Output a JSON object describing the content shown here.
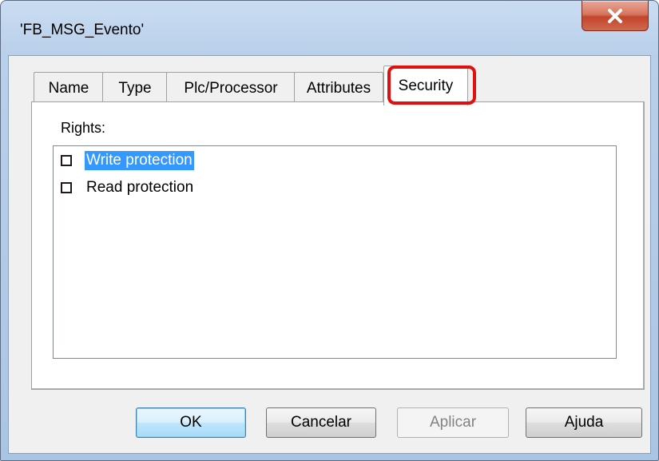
{
  "window": {
    "title": "'FB_MSG_Evento'",
    "close_label": "X"
  },
  "tabs": [
    {
      "label": "Name",
      "active": false
    },
    {
      "label": "Type",
      "active": false
    },
    {
      "label": "Plc/Processor",
      "active": false
    },
    {
      "label": "Attributes",
      "active": false
    },
    {
      "label": "Security",
      "active": true
    }
  ],
  "security": {
    "rights_label": "Rights:",
    "items": [
      {
        "label": "Write protection",
        "checked": false,
        "selected": true
      },
      {
        "label": "Read protection",
        "checked": false,
        "selected": false
      }
    ]
  },
  "buttons": {
    "ok": "OK",
    "cancel": "Cancelar",
    "apply": "Aplicar",
    "help": "Ajuda"
  },
  "colors": {
    "highlight_ring": "#e11010",
    "selection": "#3399ff",
    "close_button": "#c2452b"
  }
}
